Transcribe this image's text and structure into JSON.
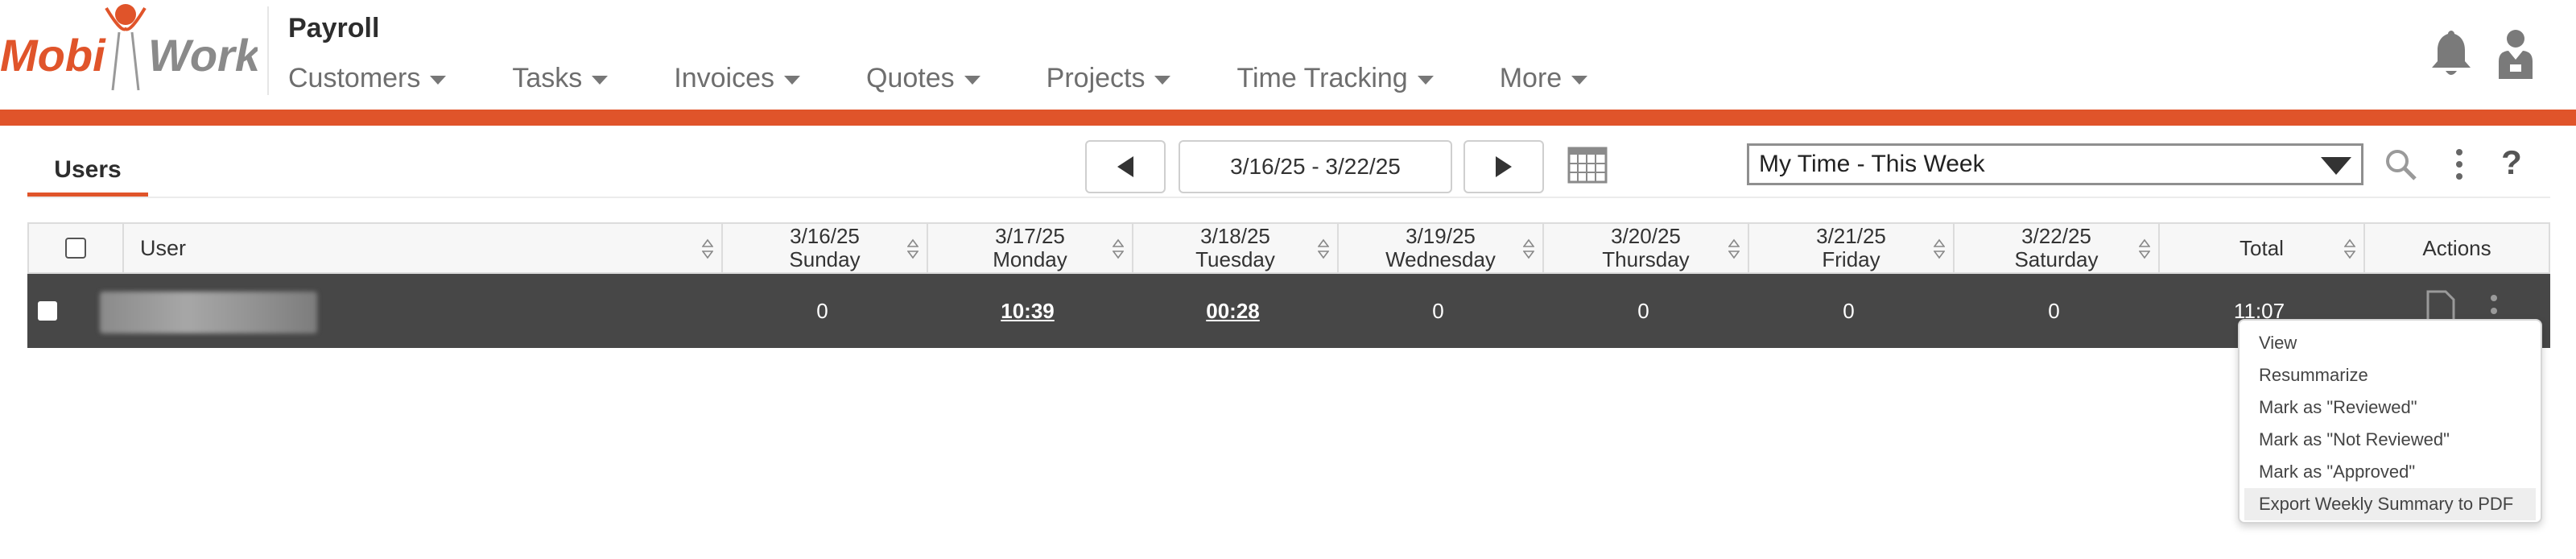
{
  "app": {
    "logo_text_left": "Mobi",
    "logo_text_right": "Work",
    "title": "Payroll"
  },
  "nav": {
    "items": [
      {
        "label": "Customers"
      },
      {
        "label": "Tasks"
      },
      {
        "label": "Invoices"
      },
      {
        "label": "Quotes"
      },
      {
        "label": "Projects"
      },
      {
        "label": "Time Tracking"
      },
      {
        "label": "More"
      }
    ]
  },
  "toolbar": {
    "tab_label": "Users",
    "date_range": "3/16/25 - 3/22/25",
    "filter_selected": "My Time - This Week",
    "help_label": "?"
  },
  "table": {
    "columns": [
      {
        "label": "User"
      },
      {
        "date": "3/16/25",
        "day": "Sunday"
      },
      {
        "date": "3/17/25",
        "day": "Monday"
      },
      {
        "date": "3/18/25",
        "day": "Tuesday"
      },
      {
        "date": "3/19/25",
        "day": "Wednesday"
      },
      {
        "date": "3/20/25",
        "day": "Thursday"
      },
      {
        "date": "3/21/25",
        "day": "Friday"
      },
      {
        "date": "3/22/25",
        "day": "Saturday"
      },
      {
        "label": "Total"
      },
      {
        "label": "Actions"
      }
    ],
    "rows": [
      {
        "user": "",
        "sun": "0",
        "mon": "10:39",
        "tue": "00:28",
        "wed": "0",
        "thu": "0",
        "fri": "0",
        "sat": "0",
        "total": "11:07"
      }
    ]
  },
  "context_menu": {
    "items": [
      {
        "label": "View"
      },
      {
        "label": "Resummarize"
      },
      {
        "label": "Mark as \"Reviewed\""
      },
      {
        "label": "Mark as \"Not Reviewed\""
      },
      {
        "label": "Mark as \"Approved\""
      },
      {
        "label": "Export Weekly Summary to PDF"
      }
    ]
  },
  "colors": {
    "brand_orange": "#e0542a",
    "row_dark": "#474747",
    "header_bg": "#f7f7f7"
  },
  "icons": [
    "bell-icon",
    "user-profile-icon",
    "prev-arrow-icon",
    "next-arrow-icon",
    "calendar-icon",
    "dropdown-caret-icon",
    "search-icon",
    "kebab-menu-icon",
    "help-icon",
    "sort-icon",
    "document-icon"
  ]
}
